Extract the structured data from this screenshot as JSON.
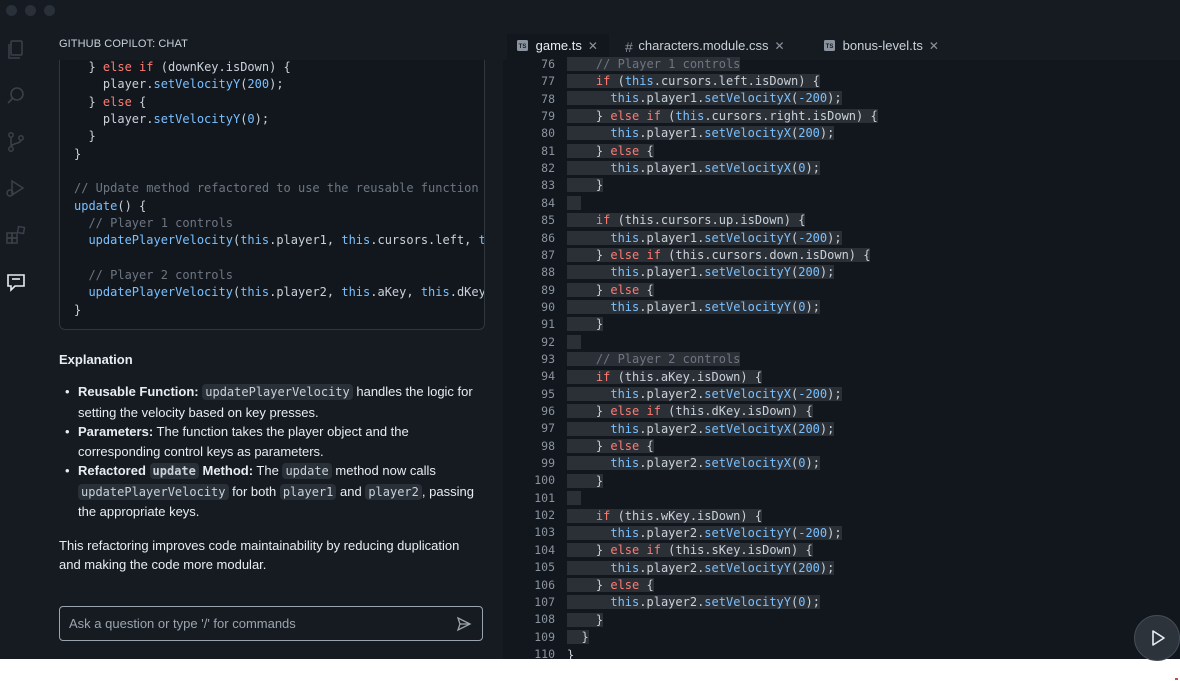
{
  "window": {
    "traffic_lights": [
      "close",
      "minimize",
      "zoom"
    ]
  },
  "activity_bar": {
    "icons": [
      "files-icon",
      "search-icon",
      "source-control-icon",
      "run-debug-icon",
      "extensions-icon",
      "chat-icon"
    ]
  },
  "chat": {
    "header": "GITHUB COPILOT: CHAT",
    "code_lines": [
      "  } else if (downKey.isDown) {",
      "    player.setVelocityY(200);",
      "  } else {",
      "    player.setVelocityY(0);",
      "  }",
      "}",
      "",
      "// Update method refactored to use the reusable function",
      "update() {",
      "  // Player 1 controls",
      "  updatePlayerVelocity(this.player1, this.cursors.left, t",
      "",
      "  // Player 2 controls",
      "  updatePlayerVelocity(this.player2, this.aKey, this.dKey",
      "}"
    ],
    "explanation_title": "Explanation",
    "bullets": [
      {
        "label": "Reusable Function:",
        "code": "updatePlayerVelocity",
        "text": " handles the logic for setting the velocity based on key presses."
      },
      {
        "label": "Parameters:",
        "text": " The function takes the player object and the corresponding control keys as parameters."
      },
      {
        "label_pre": "Refactored ",
        "label_code": "update",
        "label_post": " Method:",
        "text_a": " The ",
        "code_a": "update",
        "text_b": " method now calls ",
        "code_b": "updatePlayerVelocity",
        "text_c": " for both ",
        "code_c": "player1",
        "text_d": " and ",
        "code_d": "player2",
        "text_e": ", passing the appropriate keys."
      }
    ],
    "summary": "This refactoring improves code maintainability by reducing duplication and making the code more modular.",
    "input_placeholder": "Ask a question or type '/' for commands"
  },
  "editor": {
    "tabs": [
      {
        "label": "game.ts",
        "icon": "ts-file-icon",
        "active": true
      },
      {
        "label": "characters.module.css",
        "icon": "css-file-icon",
        "active": false
      },
      {
        "label": "bonus-level.ts",
        "icon": "ts-file-icon",
        "active": false
      }
    ],
    "line_numbers": [
      "76",
      "77",
      "78",
      "79",
      "80",
      "81",
      "82",
      "83",
      "84",
      "85",
      "86",
      "87",
      "88",
      "89",
      "90",
      "91",
      "92",
      "93",
      "94",
      "95",
      "96",
      "97",
      "98",
      "99",
      "100",
      "101",
      "102",
      "103",
      "104",
      "105",
      "106",
      "107",
      "108",
      "109",
      "110"
    ],
    "code_lines": [
      "    // Player 1 controls",
      "    if (this.cursors.left.isDown) {",
      "      this.player1.setVelocityX(-200);",
      "    } else if (this.cursors.right.isDown) {",
      "      this.player1.setVelocityX(200);",
      "    } else {",
      "      this.player1.setVelocityX(0);",
      "    }",
      "",
      "    if (this.cursors.up.isDown) {",
      "      this.player1.setVelocityY(-200);",
      "    } else if (this.cursors.down.isDown) {",
      "      this.player1.setVelocityY(200);",
      "    } else {",
      "      this.player1.setVelocityY(0);",
      "    }",
      "",
      "    // Player 2 controls",
      "    if (this.aKey.isDown) {",
      "      this.player2.setVelocityX(-200);",
      "    } else if (this.dKey.isDown) {",
      "      this.player2.setVelocityX(200);",
      "    } else {",
      "      this.player2.setVelocityX(0);",
      "    }",
      "",
      "    if (this.wKey.isDown) {",
      "      this.player2.setVelocityY(-200);",
      "    } else if (this.sKey.isDown) {",
      "      this.player2.setVelocityY(200);",
      "    } else {",
      "      this.player2.setVelocityY(0);",
      "    }",
      "  }",
      "}"
    ]
  },
  "run_button": {
    "icon": "play-icon"
  },
  "colors": {
    "background": "#161b22",
    "editor_background": "#12171e",
    "selection": "#2b3037",
    "keyword": "#ff7b72",
    "function": "#79c0ff",
    "comment": "#6e7681",
    "text": "#c9d1d9"
  }
}
